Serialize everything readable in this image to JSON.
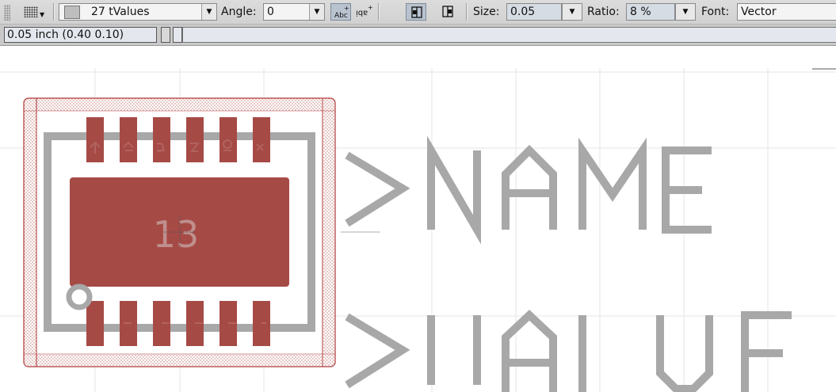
{
  "toolbar": {
    "layer_combo": "27 tValues",
    "angle_label": "Angle:",
    "angle_value": "0",
    "size_label": "Size:",
    "size_value": "0.05",
    "ratio_label": "Ratio:",
    "ratio_value": "8 %",
    "font_label": "Font:",
    "font_value": "Vector",
    "text_glyph_abc": "Abc",
    "text_glyph_mirror": "ᴉqɐ"
  },
  "status": {
    "coordinate_display": "0.05 inch (0.40 0.10)",
    "command_line": ""
  },
  "canvas": {
    "pad_number": "13",
    "name_placeholder": ">NAME",
    "value_placeholder": ">VALUE",
    "colors": {
      "pad": "#a64a46",
      "silkscreen": "#a8a8a8",
      "grid": "#e6e6e6",
      "outline": "#b03a3a"
    }
  }
}
